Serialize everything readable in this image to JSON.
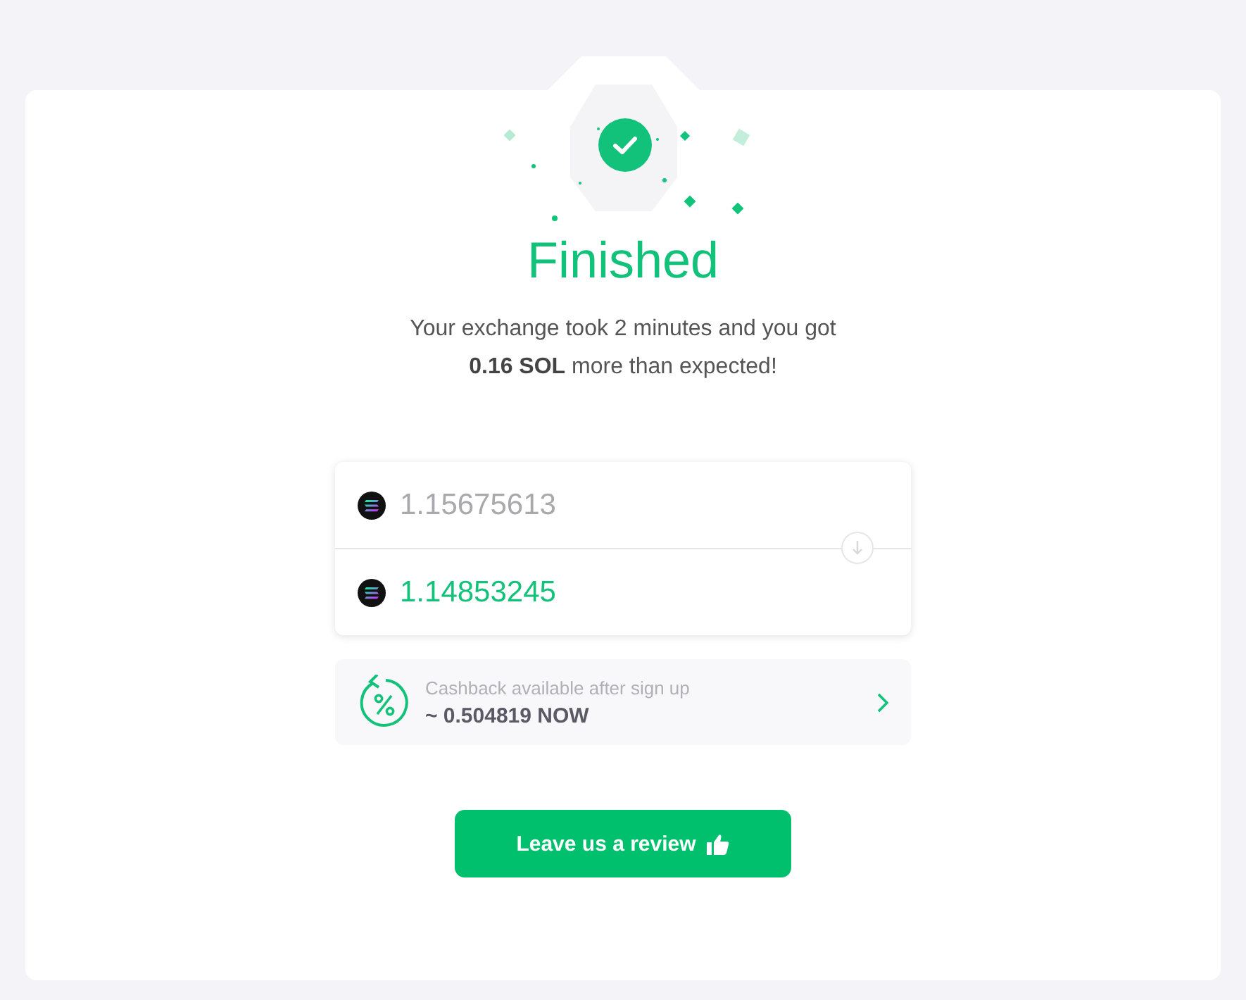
{
  "status": {
    "title": "Finished",
    "message": "Your exchange took 2 minutes and you got\n**0.16 SOL** more than expected!"
  },
  "amounts": [
    {
      "kind": "sent",
      "value": "1.15675613"
    },
    {
      "kind": "received",
      "value": "1.14853245"
    }
  ],
  "cashback": {
    "label": "Cashback available after sign up",
    "value": "~ 0.504819 NOW"
  },
  "review_button": {
    "label": "Leave us a review"
  }
}
